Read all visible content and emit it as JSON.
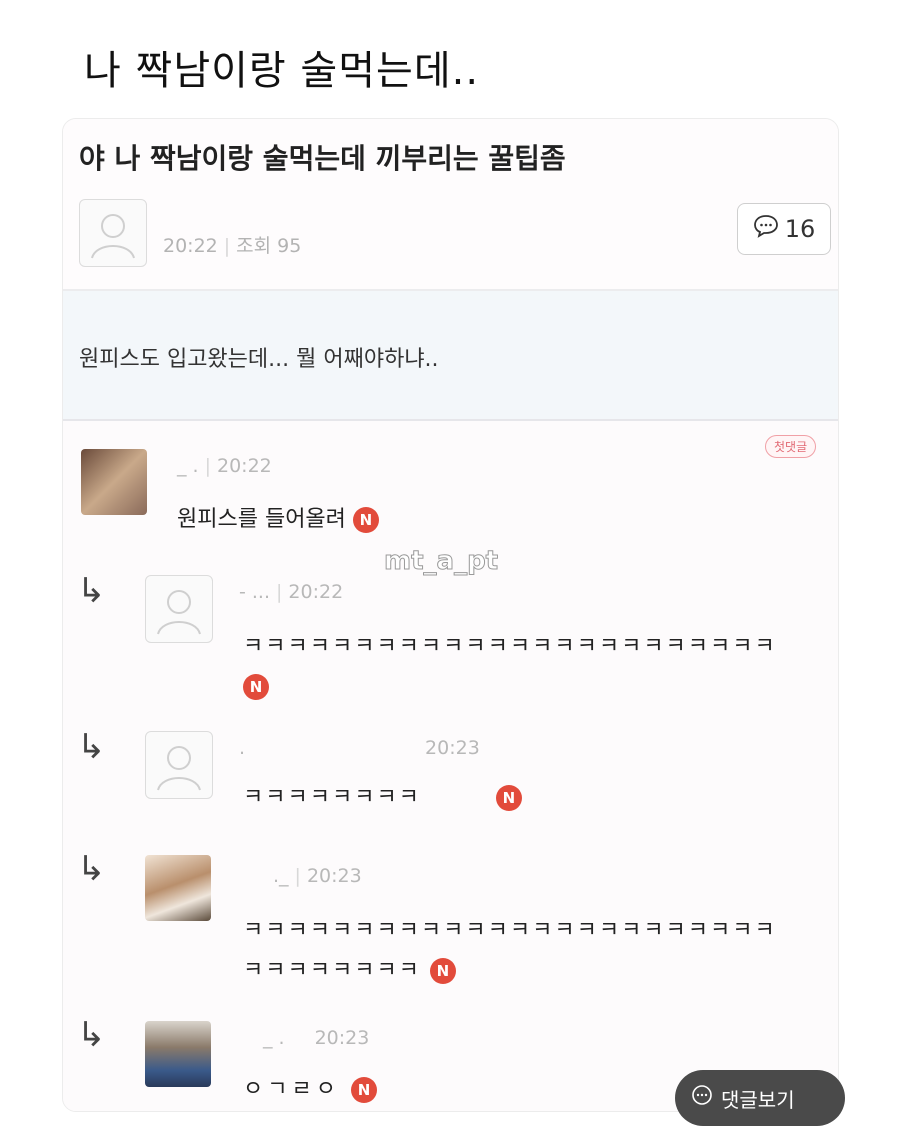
{
  "headline": "나 짝남이랑 술먹는데..",
  "post": {
    "title": "야 나 짝남이랑 술먹는데 끼부리는 꿀팁좀",
    "time": "20:22",
    "views": "조회 95",
    "comment_count": "16",
    "body": "원피스도 입고왔는데... 뭘 어째야하냐.."
  },
  "comments": [
    {
      "name": "_ .",
      "time": "20:22",
      "text": "원피스를 들어올려",
      "badge": "N",
      "first_label": "첫댓글"
    },
    {
      "name": "- ...",
      "time": "20:22",
      "text": "ㅋㅋㅋㅋㅋㅋㅋㅋㅋㅋㅋㅋㅋㅋㅋㅋㅋㅋㅋㅋㅋㅋㅋㅋ",
      "badge": "N"
    },
    {
      "name": ".",
      "time": "20:23",
      "text": "ㅋㅋㅋㅋㅋㅋㅋㅋ",
      "badge": "N"
    },
    {
      "name": "._",
      "time": "20:23",
      "text_line1": "ㅋㅋㅋㅋㅋㅋㅋㅋㅋㅋㅋㅋㅋㅋㅋㅋㅋㅋㅋㅋㅋㅋㅋㅋ",
      "text_line2": "ㅋㅋㅋㅋㅋㅋㅋㅋ",
      "badge": "N"
    },
    {
      "name": "_ .",
      "time": "20:23",
      "text": "ㅇㄱㄹㅇ",
      "badge": "N"
    }
  ],
  "watermark": "mt_a_pt",
  "view_comments": "댓글보기",
  "icons": {
    "reply": "↳",
    "comment": "comment-bubble-icon",
    "avatar": "default-avatar-icon"
  },
  "colors": {
    "badge_red": "#e24b3b",
    "body_bg": "#f3f7fa"
  }
}
